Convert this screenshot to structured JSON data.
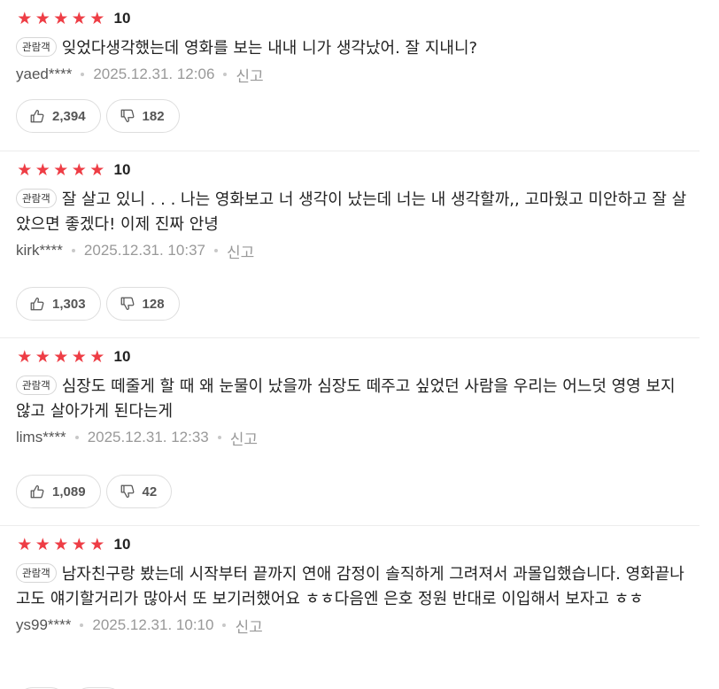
{
  "colors": {
    "star": "#ee3d45",
    "badge_border": "#d6d6d6",
    "meta_text": "#999999"
  },
  "reviews": [
    {
      "stars": 5,
      "score": "10",
      "badge": "관람객",
      "text": "잊었다생각했는데 영화를 보는 내내 니가 생각났어. 잘 지내니?",
      "author": "yaed****",
      "date": "2025.12.31. 12:06",
      "report": "신고",
      "likes": "2,394",
      "dislikes": "182"
    },
    {
      "stars": 5,
      "score": "10",
      "badge": "관람객",
      "text": "잘 살고 있니 . . . 나는 영화보고 너 생각이 났는데 너는 내 생각할까,, 고마웠고 미안하고 잘 살았으면 좋겠다! 이제 진짜 안녕",
      "author": "kirk****",
      "date": "2025.12.31. 10:37",
      "report": "신고",
      "likes": "1,303",
      "dislikes": "128"
    },
    {
      "stars": 5,
      "score": "10",
      "badge": "관람객",
      "text": "심장도 떼줄게 할 때 왜 눈물이 났을까 심장도 떼주고 싶었던 사람을 우리는 어느덧 영영 보지 않고 살아가게 된다는게",
      "author": "lims****",
      "date": "2025.12.31. 12:33",
      "report": "신고",
      "likes": "1,089",
      "dislikes": "42"
    },
    {
      "stars": 5,
      "score": "10",
      "badge": "관람객",
      "text": "남자친구랑 봤는데 시작부터 끝까지 연애 감정이 솔직하게 그려져서 과몰입했습니다. 영화끝나고도 얘기할거리가 많아서 또 보기러했어요 ㅎㅎ다음엔 은호 정원 반대로 이입해서 보자고 ㅎㅎ",
      "author": "ys99****",
      "date": "2025.12.31. 10:10",
      "report": "신고",
      "likes": "",
      "dislikes": ""
    }
  ]
}
